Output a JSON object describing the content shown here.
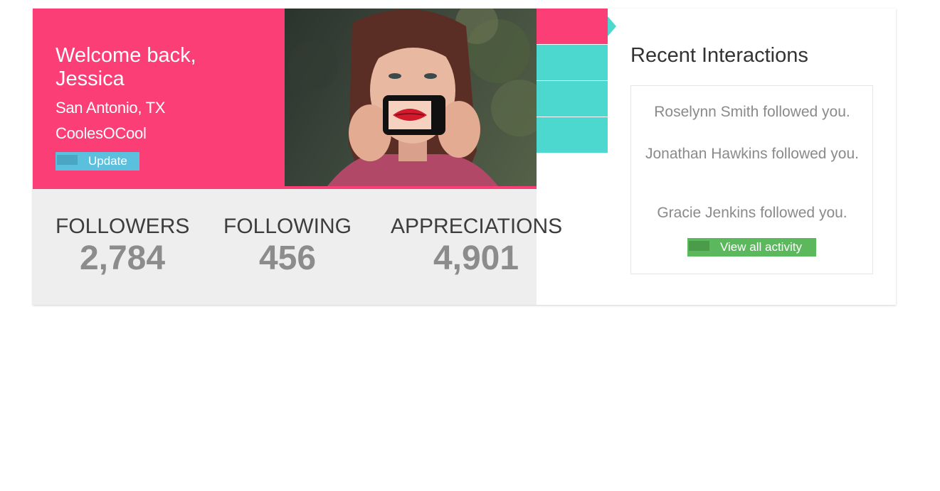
{
  "profile": {
    "welcome": "Welcome back, Jessica",
    "location": "San Antonio, TX",
    "username": "CoolesOCool",
    "update_label": "Update"
  },
  "stats": [
    {
      "label": "FOLLOWERS",
      "value": "2,784"
    },
    {
      "label": "FOLLOWING",
      "value": "456"
    },
    {
      "label": "APPRECIATIONS",
      "value": "4,901"
    }
  ],
  "tabs": [
    {
      "name": "tab-1",
      "active": true
    },
    {
      "name": "tab-2",
      "active": false
    },
    {
      "name": "tab-3",
      "active": false
    },
    {
      "name": "tab-4",
      "active": false
    }
  ],
  "interactions": {
    "title": "Recent Interactions",
    "items": [
      "Roselynn Smith followed you.",
      "Jonathan Hawkins followed you.",
      "Gracie Jenkins followed you."
    ],
    "view_all_label": "View all activity"
  },
  "colors": {
    "accent_pink": "#fc3e76",
    "accent_teal": "#4cd7cf",
    "update_blue": "#5bc0de",
    "view_all_green": "#5cb85c",
    "stats_bg": "#eeeeee"
  },
  "icons": {
    "update": "update-icon",
    "view_all": "activity-icon"
  }
}
